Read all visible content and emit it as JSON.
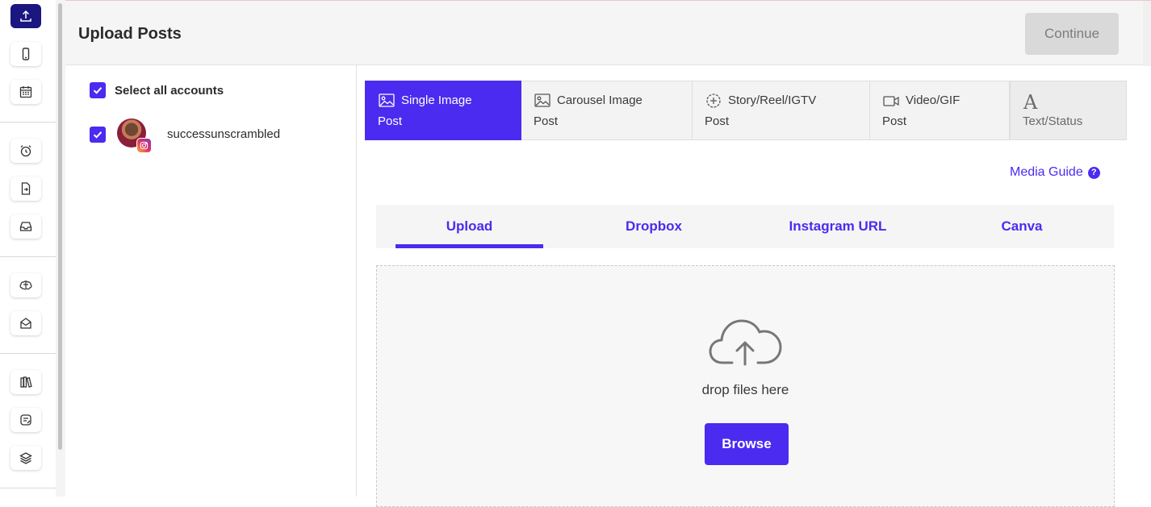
{
  "header": {
    "title": "Upload Posts",
    "continue_label": "Continue"
  },
  "accounts": {
    "select_all_label": "Select all accounts",
    "items": [
      {
        "name": "successunscrambled",
        "network": "instagram"
      }
    ]
  },
  "post_types": [
    {
      "line1": "Single Image",
      "line2": "Post",
      "icon": "image-icon",
      "active": true
    },
    {
      "line1": "Carousel Image",
      "line2": "Post",
      "icon": "image-icon",
      "active": false
    },
    {
      "line1": "Story/Reel/IGTV",
      "line2": "Post",
      "icon": "plus-circle-icon",
      "active": false
    },
    {
      "line1": "Video/GIF",
      "line2": "Post",
      "icon": "video-camera-icon",
      "active": false
    },
    {
      "glyph": "A",
      "line2": "Text/Status",
      "icon": "text-icon",
      "active": false
    }
  ],
  "media_guide": {
    "label": "Media Guide",
    "help_glyph": "?"
  },
  "source_tabs": [
    {
      "label": "Upload",
      "active": true
    },
    {
      "label": "Dropbox",
      "active": false
    },
    {
      "label": "Instagram URL",
      "active": false
    },
    {
      "label": "Canva",
      "active": false
    }
  ],
  "dropzone": {
    "text": "drop files here",
    "browse_label": "Browse"
  },
  "sidebar_icons": [
    "upload-icon",
    "phone-icon",
    "calendar-icon",
    "alarm-clock-icon",
    "file-import-icon",
    "inbox-icon",
    "brain-icon",
    "envelope-open-icon",
    "library-icon",
    "notes-icon",
    "layers-icon"
  ],
  "colors": {
    "accent": "#4b2bf0",
    "sidebar_active": "#1b1680",
    "disabled_button": "#d9d9d9"
  }
}
